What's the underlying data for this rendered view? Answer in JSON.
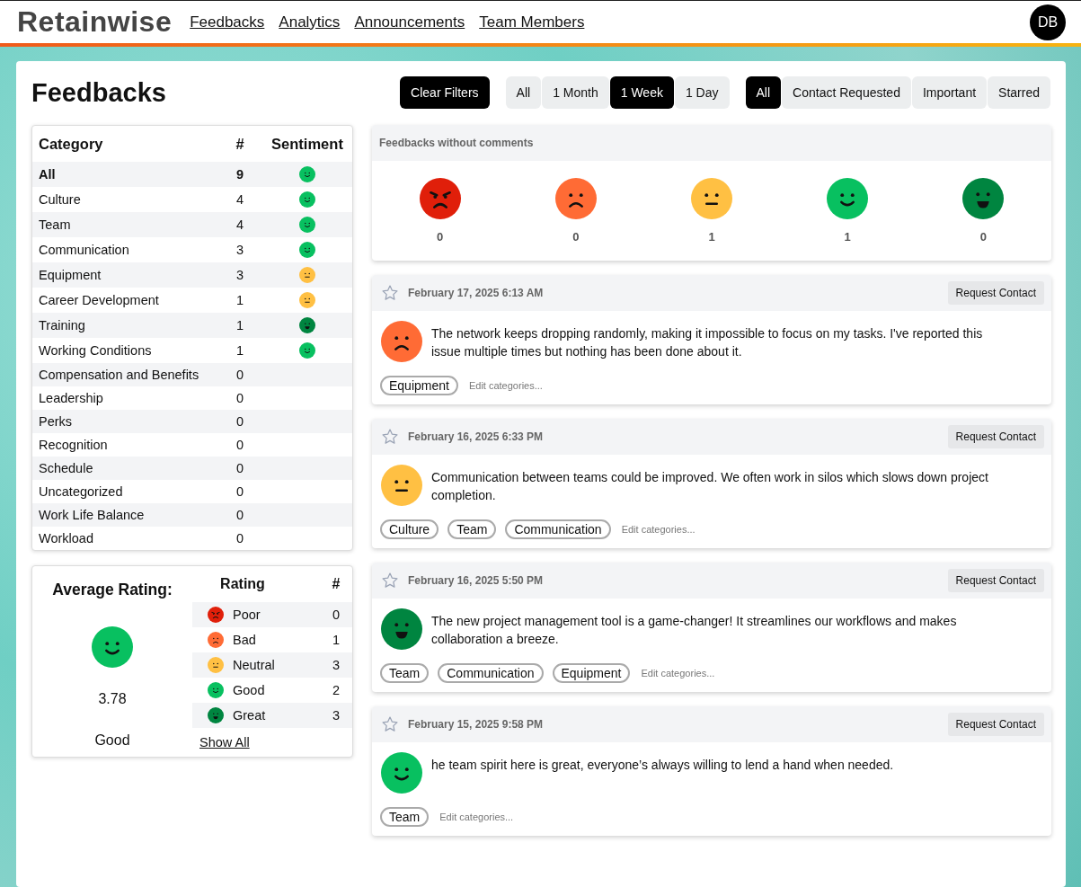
{
  "header": {
    "logo": "Retainwise",
    "nav": [
      "Feedbacks",
      "Analytics",
      "Announcements",
      "Team Members"
    ],
    "avatar": "DB"
  },
  "page_title": "Feedbacks",
  "clear_filters": "Clear Filters",
  "time_filters": [
    {
      "label": "All",
      "selected": false
    },
    {
      "label": "1 Month",
      "selected": false
    },
    {
      "label": "1 Week",
      "selected": true
    },
    {
      "label": "1 Day",
      "selected": false
    }
  ],
  "type_filters": [
    {
      "label": "All",
      "selected": true
    },
    {
      "label": "Contact Requested",
      "selected": false
    },
    {
      "label": "Important",
      "selected": false
    },
    {
      "label": "Starred",
      "selected": false
    }
  ],
  "category_table": {
    "columns": [
      "Category",
      "#",
      "Sentiment"
    ],
    "rows": [
      {
        "name": "All",
        "count": "9",
        "kind": "good",
        "selected": true
      },
      {
        "name": "Culture",
        "count": "4",
        "kind": "good",
        "selected": false
      },
      {
        "name": "Team",
        "count": "4",
        "kind": "good",
        "selected": false
      },
      {
        "name": "Communication",
        "count": "3",
        "kind": "good",
        "selected": false
      },
      {
        "name": "Equipment",
        "count": "3",
        "kind": "neutral",
        "selected": false
      },
      {
        "name": "Career Development",
        "count": "1",
        "kind": "neutral",
        "selected": false
      },
      {
        "name": "Training",
        "count": "1",
        "kind": "great",
        "selected": false
      },
      {
        "name": "Working Conditions",
        "count": "1",
        "kind": "good",
        "selected": false
      },
      {
        "name": "Compensation and Benefits",
        "count": "0",
        "selected": false
      },
      {
        "name": "Leadership",
        "count": "0",
        "selected": false
      },
      {
        "name": "Perks",
        "count": "0",
        "selected": false
      },
      {
        "name": "Recognition",
        "count": "0",
        "selected": false
      },
      {
        "name": "Schedule",
        "count": "0",
        "selected": false
      },
      {
        "name": "Uncategorized",
        "count": "0",
        "selected": false
      },
      {
        "name": "Work Life Balance",
        "count": "0",
        "selected": false
      },
      {
        "name": "Workload",
        "count": "0",
        "selected": false
      }
    ]
  },
  "rating_summary": {
    "title": "Average Rating:",
    "kind": "good",
    "score": "3.78",
    "label": "Good",
    "columns": [
      "Rating",
      "#"
    ],
    "rows": [
      {
        "kind": "poor",
        "label": "Poor",
        "count": "0"
      },
      {
        "kind": "bad",
        "label": "Bad",
        "count": "1"
      },
      {
        "kind": "neutral",
        "label": "Neutral",
        "count": "3"
      },
      {
        "kind": "good",
        "label": "Good",
        "count": "2"
      },
      {
        "kind": "great",
        "label": "Great",
        "count": "3"
      }
    ],
    "show_all": "Show All"
  },
  "no_comment_summary": {
    "title": "Feedbacks without comments",
    "items": [
      {
        "kind": "poor",
        "count": "0"
      },
      {
        "kind": "bad",
        "count": "0"
      },
      {
        "kind": "neutral",
        "count": "1"
      },
      {
        "kind": "good",
        "count": "1"
      },
      {
        "kind": "great",
        "count": "0"
      }
    ]
  },
  "feedbacks": [
    {
      "starred": false,
      "date": "February 17, 2025 6:13 AM",
      "action": "Request Contact",
      "kind": "bad",
      "text": "The network keeps dropping randomly, making it impossible to focus on my tasks. I've reported this issue multiple times but nothing has been done about it.",
      "tags": [
        "Equipment"
      ],
      "edit_label": "Edit categories..."
    },
    {
      "starred": false,
      "date": "February 16, 2025 6:33 PM",
      "action": "Request Contact",
      "kind": "neutral",
      "text": "Communication between teams could be improved. We often work in silos which slows down project completion.",
      "tags": [
        "Culture",
        "Team",
        "Communication"
      ],
      "edit_label": "Edit categories..."
    },
    {
      "starred": false,
      "date": "February 16, 2025 5:50 PM",
      "action": "Request Contact",
      "kind": "great",
      "text": "The new project management tool is a game-changer! It streamlines our workflows and makes collaboration a breeze.",
      "tags": [
        "Team",
        "Communication",
        "Equipment"
      ],
      "edit_label": "Edit categories..."
    },
    {
      "starred": false,
      "date": "February 15, 2025 9:58 PM",
      "action": "Request Contact",
      "kind": "good",
      "text": "he team spirit here is great, everyone’s always willing to lend a hand when needed.",
      "tags": [
        "Team"
      ],
      "edit_label": "Edit categories..."
    }
  ]
}
